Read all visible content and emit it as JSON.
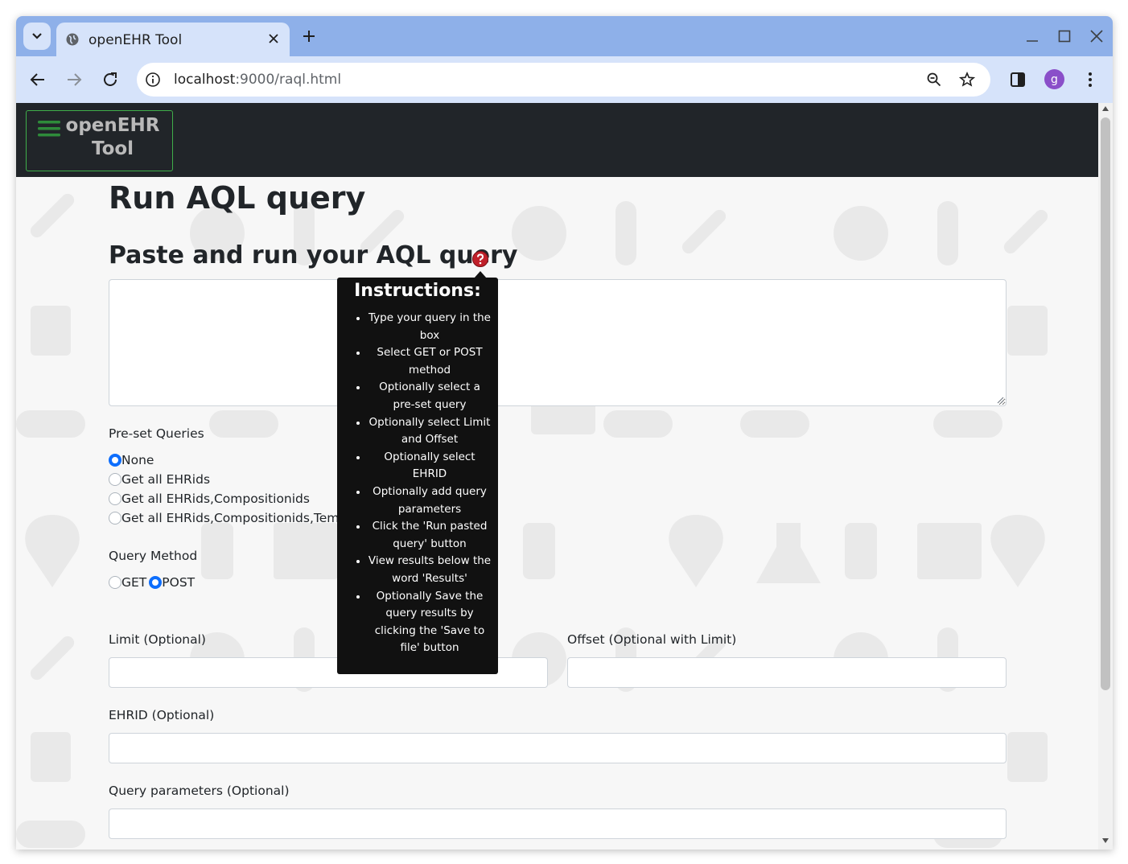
{
  "browser": {
    "tab_title": "openEHR Tool",
    "url_host": "localhost",
    "url_path": ":9000/raql.html",
    "profile_initial": "g"
  },
  "app": {
    "brand_line1": "openEHR",
    "brand_line2": "Tool",
    "page_title": "Run AQL query",
    "section_title": "Paste and run your AQL query",
    "query_text": "",
    "preset_label": "Pre-set Queries",
    "preset_options": [
      {
        "label": "None",
        "checked": true
      },
      {
        "label": "Get all EHRids",
        "checked": false
      },
      {
        "label": "Get all EHRids,Compositionids",
        "checked": false
      },
      {
        "label": "Get all EHRids,Compositionids,Templateids",
        "checked": false
      }
    ],
    "method_label": "Query Method",
    "method_options": [
      {
        "label": "GET",
        "checked": false
      },
      {
        "label": "POST",
        "checked": true
      }
    ],
    "limit_label": "Limit (Optional)",
    "offset_label": "Offset (Optional with Limit)",
    "ehrid_label": "EHRID (Optional)",
    "params_label": "Query parameters (Optional)",
    "limit_value": "",
    "offset_value": "",
    "ehrid_value": "",
    "params_value": ""
  },
  "tooltip": {
    "title": "Instructions:",
    "items": [
      "Type your query in the box",
      "Select GET or POST method",
      "Optionally select a pre-set query",
      "Optionally select Limit and Offset",
      "Optionally select EHRID",
      "Optionally add query parameters",
      "Click the 'Run pasted query' button",
      "View results below the word 'Results'",
      "Optionally Save the query results by clicking the 'Save to file' button"
    ]
  },
  "colors": {
    "navbar": "#212529",
    "accent": "#0d6efd",
    "brand_border": "#3fae4a",
    "help_icon": "#c0202a",
    "tab_strip": "#8eb0e9",
    "toolbar": "#d6e3fa"
  }
}
